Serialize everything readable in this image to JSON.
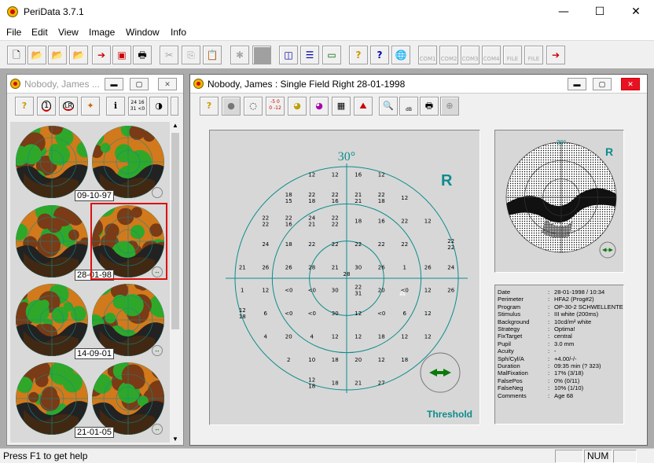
{
  "app": {
    "title": "PeriData 3.7.1"
  },
  "window_controls": {
    "minimize": "—",
    "maximize": "☐",
    "close": "✕"
  },
  "menu": [
    "File",
    "Edit",
    "View",
    "Image",
    "Window",
    "Info"
  ],
  "toolbar": {
    "com_labels": [
      "COM1",
      "COM2",
      "COM3",
      "COM4",
      "FILE",
      "FILE"
    ]
  },
  "left_window": {
    "title": "Nobody, James ...",
    "toolbar_labels": {
      "circle1": "1",
      "circle_lr": "LR",
      "info": "i",
      "numbers_top": "24 16",
      "numbers_bottom": "31 <0"
    },
    "thumbs": [
      {
        "date": "09-10-97"
      },
      {
        "date": "28-01-98"
      },
      {
        "date": "14-09-01"
      },
      {
        "date": "21-01-05"
      }
    ]
  },
  "main_window": {
    "title": "Nobody, James  :  Single Field  Right  28-01-1998",
    "toolbar_labels": {
      "neg": "-5",
      "neg2": "-12",
      "zero": "0",
      "db": "dB"
    },
    "field": {
      "degree_label": "30°",
      "eye_label": "R",
      "mode_label": "Threshold",
      "values": [
        {
          "x": -3,
          "y": 9,
          "v": "12"
        },
        {
          "x": -1,
          "y": 9,
          "v": "12"
        },
        {
          "x": 1,
          "y": 9,
          "v": "16"
        },
        {
          "x": 3,
          "y": 9,
          "v": "12"
        },
        {
          "x": -5,
          "y": 7,
          "v": "18\n15"
        },
        {
          "x": -3,
          "y": 7,
          "v": "22\n18"
        },
        {
          "x": -1,
          "y": 7,
          "v": "22\n16"
        },
        {
          "x": 1,
          "y": 7,
          "v": "21\n21"
        },
        {
          "x": 3,
          "y": 7,
          "v": "22\n18"
        },
        {
          "x": 5,
          "y": 7,
          "v": "12"
        },
        {
          "x": -7,
          "y": 5,
          "v": "22\n22"
        },
        {
          "x": -5,
          "y": 5,
          "v": "22\n16"
        },
        {
          "x": -3,
          "y": 5,
          "v": "24\n21"
        },
        {
          "x": -1,
          "y": 5,
          "v": "22\n22"
        },
        {
          "x": 1,
          "y": 5,
          "v": "18"
        },
        {
          "x": 3,
          "y": 5,
          "v": "16"
        },
        {
          "x": 5,
          "y": 5,
          "v": "22"
        },
        {
          "x": 7,
          "y": 5,
          "v": "12"
        },
        {
          "x": -7,
          "y": 3,
          "v": "24"
        },
        {
          "x": -5,
          "y": 3,
          "v": "18"
        },
        {
          "x": -3,
          "y": 3,
          "v": "22"
        },
        {
          "x": -1,
          "y": 3,
          "v": "22"
        },
        {
          "x": 1,
          "y": 3,
          "v": "22"
        },
        {
          "x": 3,
          "y": 3,
          "v": "22"
        },
        {
          "x": 5,
          "y": 3,
          "v": "22"
        },
        {
          "x": 9,
          "y": 3,
          "v": "22\n22"
        },
        {
          "x": -9,
          "y": 1,
          "v": "21"
        },
        {
          "x": -7,
          "y": 1,
          "v": "26"
        },
        {
          "x": -5,
          "y": 1,
          "v": "26"
        },
        {
          "x": -3,
          "y": 1,
          "v": "28"
        },
        {
          "x": -1,
          "y": 1,
          "v": "21"
        },
        {
          "x": 1,
          "y": 1,
          "v": "30"
        },
        {
          "x": 3,
          "y": 1,
          "v": "26"
        },
        {
          "x": 5,
          "y": 1,
          "v": "1"
        },
        {
          "x": 7,
          "y": 1,
          "v": "26"
        },
        {
          "x": 9,
          "y": 1,
          "v": "24"
        },
        {
          "x": 0,
          "y": 0.4,
          "v": "28"
        },
        {
          "x": -9,
          "y": -1,
          "v": "1"
        },
        {
          "x": -7,
          "y": -1,
          "v": "12"
        },
        {
          "x": -5,
          "y": -1,
          "v": "<0"
        },
        {
          "x": -3,
          "y": -1,
          "v": "<0"
        },
        {
          "x": -1,
          "y": -1,
          "v": "30"
        },
        {
          "x": 1,
          "y": -1,
          "v": "22\n31"
        },
        {
          "x": 3,
          "y": -1,
          "v": "20"
        },
        {
          "x": 5,
          "y": -1,
          "v": "<0"
        },
        {
          "x": 7,
          "y": -1,
          "v": "12"
        },
        {
          "x": 9,
          "y": -1,
          "v": "26"
        },
        {
          "x": -9,
          "y": -3,
          "v": "12\n18"
        },
        {
          "x": -7,
          "y": -3,
          "v": "6"
        },
        {
          "x": -5,
          "y": -3,
          "v": "<0"
        },
        {
          "x": -3,
          "y": -3,
          "v": "<0"
        },
        {
          "x": -1,
          "y": -3,
          "v": "30"
        },
        {
          "x": 1,
          "y": -3,
          "v": "12"
        },
        {
          "x": 3,
          "y": -3,
          "v": "<0"
        },
        {
          "x": 5,
          "y": -3,
          "v": "6"
        },
        {
          "x": 7,
          "y": -3,
          "v": "12"
        },
        {
          "x": -7,
          "y": -5,
          "v": "4"
        },
        {
          "x": -5,
          "y": -5,
          "v": "20"
        },
        {
          "x": -3,
          "y": -5,
          "v": "4"
        },
        {
          "x": -1,
          "y": -5,
          "v": "12"
        },
        {
          "x": 1,
          "y": -5,
          "v": "12"
        },
        {
          "x": 3,
          "y": -5,
          "v": "18"
        },
        {
          "x": 5,
          "y": -5,
          "v": "12"
        },
        {
          "x": 7,
          "y": -5,
          "v": "12"
        },
        {
          "x": -5,
          "y": -7,
          "v": "2"
        },
        {
          "x": -3,
          "y": -7,
          "v": "10"
        },
        {
          "x": -1,
          "y": -7,
          "v": "18"
        },
        {
          "x": 1,
          "y": -7,
          "v": "20"
        },
        {
          "x": 3,
          "y": -7,
          "v": "12"
        },
        {
          "x": 5,
          "y": -7,
          "v": "18"
        },
        {
          "x": -3,
          "y": -9,
          "v": "12\n18"
        },
        {
          "x": -1,
          "y": -9,
          "v": "18"
        },
        {
          "x": 1,
          "y": -9,
          "v": "21"
        },
        {
          "x": 3,
          "y": -9,
          "v": "27"
        }
      ]
    },
    "mini": {
      "degree_label": "30°",
      "eye_label": "R"
    },
    "info": [
      {
        "k": "Date",
        "v": "28-01-1998 / 10:34"
      },
      {
        "k": "Perimeter",
        "v": "HFA2 (Prog#2)"
      },
      {
        "k": "Program",
        "v": "OP-30-2 SCHWELLENTE"
      },
      {
        "k": "Stimulus",
        "v": "III white (200ms)"
      },
      {
        "k": "Background",
        "v": "10cd/m² white"
      },
      {
        "k": "Strategy",
        "v": "Optima!"
      },
      {
        "k": "FixTarget",
        "v": "central"
      },
      {
        "k": "Pupil",
        "v": "3.0 mm"
      },
      {
        "k": "Acuity",
        "v": "-"
      },
      {
        "k": "Sph/Cyl/A",
        "v": "+4.00/-/-"
      },
      {
        "k": "Duration",
        "v": "09:35 min (? 323)"
      },
      {
        "k": "MalFixation",
        "v": "17% (3/18)"
      },
      {
        "k": "FalsePos",
        "v": "0% (0/11)"
      },
      {
        "k": "FalseNeg",
        "v": "10% (1/10)"
      },
      {
        "k": "Comments",
        "v": "Age 68"
      }
    ]
  },
  "status": {
    "help": "Press F1 to get help",
    "num": "NUM"
  },
  "colors": {
    "green": "#2fa82a",
    "brown": "#7a3b16",
    "orange": "#d2791c",
    "teal": "#0e8c8c",
    "dark": "#222222"
  }
}
